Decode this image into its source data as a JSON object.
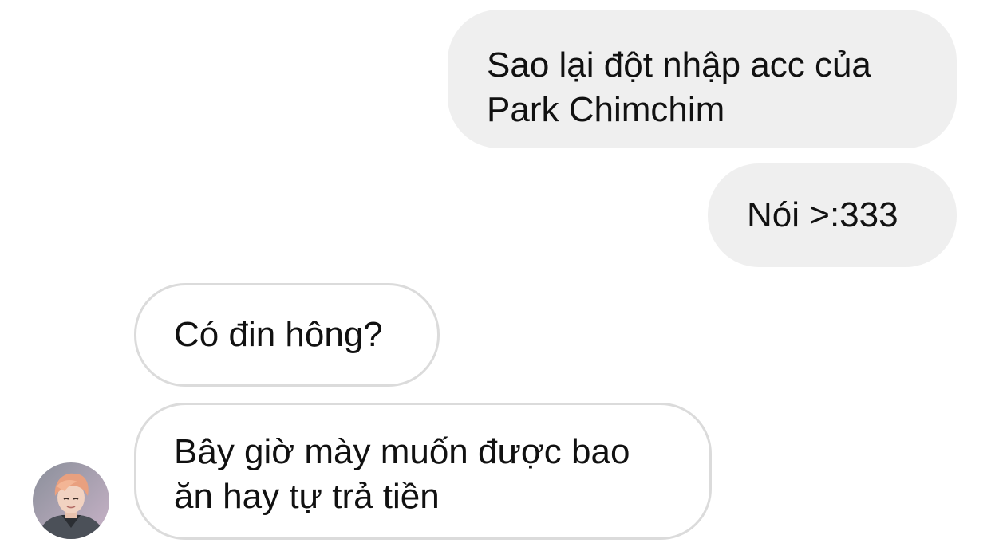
{
  "messages": [
    {
      "direction": "outgoing",
      "lines": [
        "Sao lại đột nhập acc của",
        "Park Chimchim"
      ]
    },
    {
      "direction": "outgoing",
      "lines": [
        "Nói >:333"
      ]
    },
    {
      "direction": "incoming",
      "lines": [
        "Có đin hông?"
      ]
    },
    {
      "direction": "incoming",
      "lines": [
        "Bây giờ mày muốn được bao",
        "ăn hay tự trả tiền"
      ]
    }
  ],
  "avatar": {
    "icon": "contact-avatar-photo"
  },
  "colors": {
    "outgoing_bubble": "#efefef",
    "incoming_border": "#dbdbdb",
    "text": "#111111",
    "background": "#ffffff"
  }
}
